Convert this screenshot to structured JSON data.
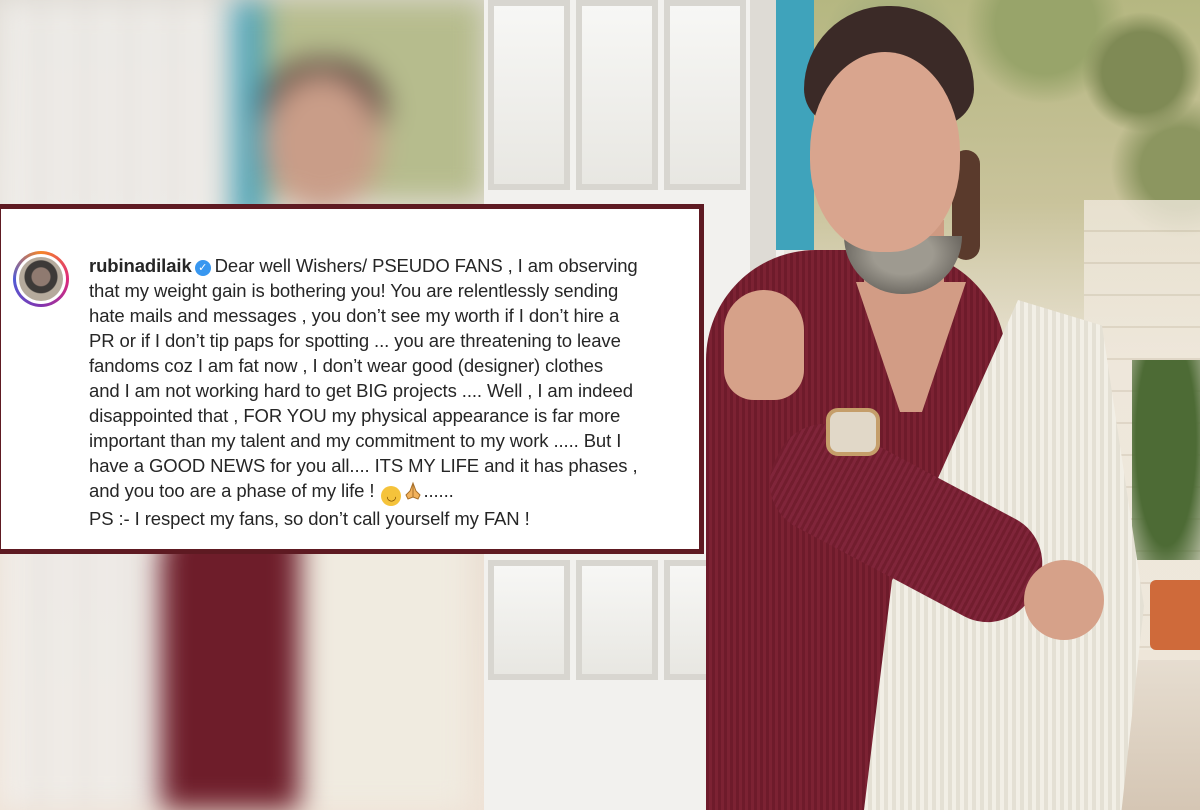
{
  "post": {
    "username": "rubinadilaik",
    "verified": true,
    "caption_lines": [
      "Dear well Wishers/ PSEUDO FANS , I am observing",
      "that my weight gain is bothering you! You are relentlessly sending",
      "hate mails and messages , you don’t see my worth if I don’t hire a",
      "PR or if I don’t tip paps for spotting ... you are threatening to leave",
      "fandoms coz I am fat now , I don’t wear good (designer) clothes",
      "and I am not working hard to get BIG projects .... Well , I am indeed",
      "disappointed that , FOR YOU my physical appearance is far more",
      "important than my talent and my commitment to my work ..... But I",
      "have a GOOD NEWS for you all.... ITS MY LIFE and it has phases ,",
      "and you too are a phase of my life !",
      "......",
      "PS :- I respect my fans, so don’t call yourself my FAN !"
    ],
    "emojis": [
      "smiling-face-icon",
      "folded-hands-icon"
    ]
  },
  "colors": {
    "card_border": "#5e1a22",
    "verified_badge": "#3897f0",
    "text": "#262626"
  }
}
